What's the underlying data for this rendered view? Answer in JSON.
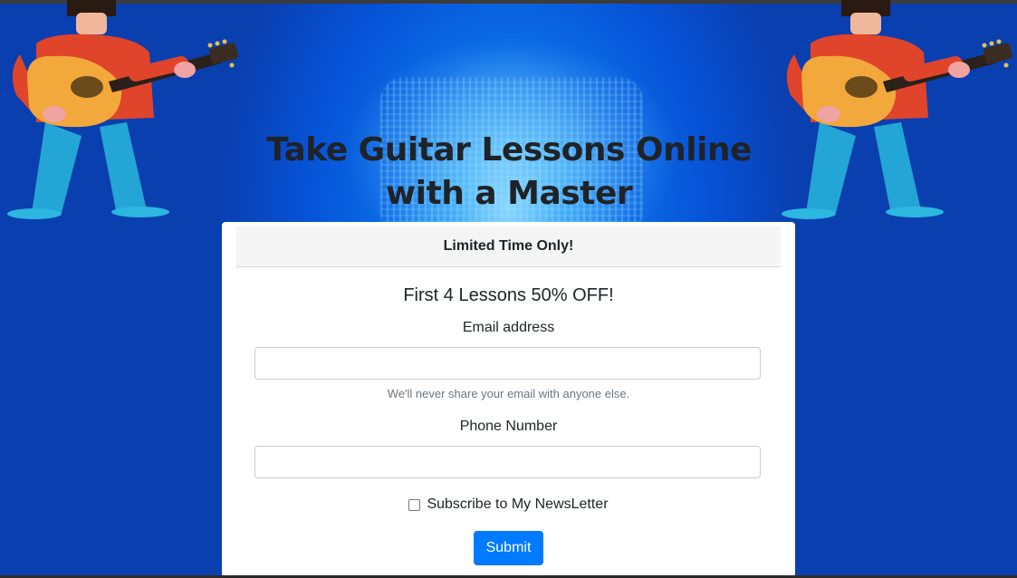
{
  "hero": {
    "title_line1": "Take Guitar Lessons Online",
    "title_line2": "with a Master"
  },
  "card": {
    "header": "Limited Time Only!",
    "title": "First 4 Lessons 50% OFF!"
  },
  "form": {
    "email_label": "Email address",
    "email_value": "",
    "email_help": "We'll never share your email with anyone else.",
    "phone_label": "Phone Number",
    "phone_value": "",
    "newsletter_label": "Subscribe to My NewsLetter",
    "newsletter_checked": false,
    "submit_label": "Submit"
  },
  "colors": {
    "background": "#0652d6",
    "submit_button": "#007bff",
    "title_text": "#1f2328"
  },
  "icons": {
    "left_illustration": "guitarist-illustration",
    "right_illustration": "guitarist-illustration"
  }
}
